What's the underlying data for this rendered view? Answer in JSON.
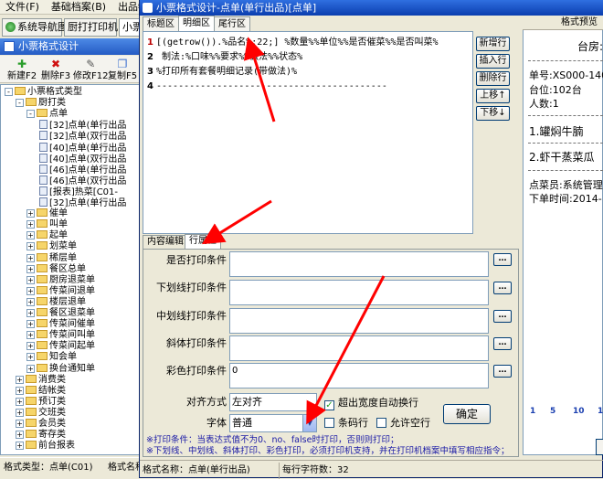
{
  "menu": [
    "文件(F)",
    "基础档案(B)",
    "出品物料(I)"
  ],
  "top_tabs": [
    "系统导航图",
    "厨打打印机",
    "小票"
  ],
  "left_panel": {
    "title": "小票格式设计",
    "toolbar": [
      "新建F2",
      "删除F3",
      "修改F12",
      "复制F5"
    ],
    "tree": [
      {
        "label": "小票格式类型",
        "level": 0,
        "type": "folder",
        "sign": "-"
      },
      {
        "label": "厨打类",
        "level": 1,
        "type": "folder",
        "sign": "-"
      },
      {
        "label": "点单",
        "level": 2,
        "type": "folder",
        "sign": "-"
      },
      {
        "label": "[32]点单(单行出品",
        "level": 3,
        "type": "doc"
      },
      {
        "label": "[32]点单(双行出品",
        "level": 3,
        "type": "doc"
      },
      {
        "label": "[40]点单(单行出品",
        "level": 3,
        "type": "doc"
      },
      {
        "label": "[40]点单(双行出品",
        "level": 3,
        "type": "doc"
      },
      {
        "label": "[46]点单(单行出品",
        "level": 3,
        "type": "doc"
      },
      {
        "label": "[46]点单(双行出品",
        "level": 3,
        "type": "doc"
      },
      {
        "label": "[报表]热菜[C01-",
        "level": 3,
        "type": "doc"
      },
      {
        "label": "[32]点单(单行出品",
        "level": 3,
        "type": "doc"
      },
      {
        "label": "催单",
        "level": 2,
        "type": "folder",
        "sign": "+"
      },
      {
        "label": "叫单",
        "level": 2,
        "type": "folder",
        "sign": "+"
      },
      {
        "label": "起单",
        "level": 2,
        "type": "folder",
        "sign": "+"
      },
      {
        "label": "划菜单",
        "level": 2,
        "type": "folder",
        "sign": "+"
      },
      {
        "label": "稀层单",
        "level": 2,
        "type": "folder",
        "sign": "+"
      },
      {
        "label": "餐区总单",
        "level": 2,
        "type": "folder",
        "sign": "+"
      },
      {
        "label": "厨房退菜单",
        "level": 2,
        "type": "folder",
        "sign": "+"
      },
      {
        "label": "传菜间退单",
        "level": 2,
        "type": "folder",
        "sign": "+"
      },
      {
        "label": "楼层退单",
        "level": 2,
        "type": "folder",
        "sign": "+"
      },
      {
        "label": "餐区退菜单",
        "level": 2,
        "type": "folder",
        "sign": "+"
      },
      {
        "label": "传菜间催单",
        "level": 2,
        "type": "folder",
        "sign": "+"
      },
      {
        "label": "传菜间叫单",
        "level": 2,
        "type": "folder",
        "sign": "+"
      },
      {
        "label": "传菜间起单",
        "level": 2,
        "type": "folder",
        "sign": "+"
      },
      {
        "label": "知会单",
        "level": 2,
        "type": "folder",
        "sign": "+"
      },
      {
        "label": "换台通知单",
        "level": 2,
        "type": "folder",
        "sign": "+"
      },
      {
        "label": "消费类",
        "level": 1,
        "type": "folder",
        "sign": "+"
      },
      {
        "label": "结帐类",
        "level": 1,
        "type": "folder",
        "sign": "+"
      },
      {
        "label": "预订类",
        "level": 1,
        "type": "folder",
        "sign": "+"
      },
      {
        "label": "交班类",
        "level": 1,
        "type": "folder",
        "sign": "+"
      },
      {
        "label": "会员类",
        "level": 1,
        "type": "folder",
        "sign": "+"
      },
      {
        "label": "寄存类",
        "level": 1,
        "type": "folder",
        "sign": "+"
      },
      {
        "label": "前台报表",
        "level": 1,
        "type": "folder",
        "sign": "+"
      }
    ],
    "status_left": "格式类型：点单(C01)",
    "status_right": "格式名称"
  },
  "dialog": {
    "title": "小票格式设计-点单(单行出品)[点单]",
    "tabs": [
      "标题区",
      "明细区",
      "尾行区"
    ],
    "active_tab": 1,
    "editor_lines": [
      {
        "no": "1",
        "text": "[(getrow()).%品名%;22;]  %数量%%单位%%是否催菜%%是否叫菜%"
      },
      {
        "no": "2",
        "text": "   制法:%口味%%要求%%做法%%状态%"
      },
      {
        "no": "3",
        "text": "%打印所有套餐明细记录(带做法)%"
      },
      {
        "no": "4",
        "text": "------------------------------------------"
      }
    ],
    "side_buttons": [
      "新增行",
      "插入行",
      "删除行",
      "上移↑",
      "下移↓"
    ],
    "bottom_tabs": [
      "内容编辑",
      "行属性"
    ],
    "active_bottom_tab": 1,
    "fields": [
      {
        "label": "是否打印条件",
        "value": ""
      },
      {
        "label": "下划线打印条件",
        "value": ""
      },
      {
        "label": "中划线打印条件",
        "value": ""
      },
      {
        "label": "斜体打印条件",
        "value": ""
      },
      {
        "label": "彩色打印条件",
        "value": "0"
      }
    ],
    "align_label": "对齐方式",
    "align_value": "左对齐",
    "font_label": "字体",
    "font_value": "普通",
    "checkboxes": [
      {
        "label": "超出宽度自动换行",
        "checked": true
      },
      {
        "label": "条码行",
        "checked": false
      },
      {
        "label": "允许空行",
        "checked": false
      }
    ],
    "ok_button": "确定",
    "notes": [
      "※打印条件：当表达式值不为0、no、false时打印，否则则打印；",
      "※下划线、中划线、斜体打印、彩色打印，必须打印机支持，并在打印机档案中填写相应指令；"
    ],
    "status_name": "格式名称：点单(单行出品)",
    "status_count": "每行字符数：32"
  },
  "preview": {
    "header": "格式预览",
    "lines": [
      {
        "text": "台房:",
        "style": "title"
      },
      {
        "text": "单号:XS000-140",
        "style": "normal"
      },
      {
        "text": "台位:102台",
        "style": "normal"
      },
      {
        "text": "人数:1",
        "style": "normal"
      },
      {
        "text": "1.罐焖牛腩",
        "style": "item"
      },
      {
        "text": "2.虾干蒸菜瓜",
        "style": "item"
      },
      {
        "text": "点菜员:系统管理",
        "style": "normal"
      },
      {
        "text": "下单时间:2014-",
        "style": "normal"
      }
    ],
    "ruler": [
      "1",
      "5",
      "10",
      "1"
    ]
  },
  "colors": {
    "title_bar": "#0b3eaf",
    "line_number": "#b00000",
    "annotation_arrow": "#ff0000",
    "note_text": "#1a1aa6"
  }
}
